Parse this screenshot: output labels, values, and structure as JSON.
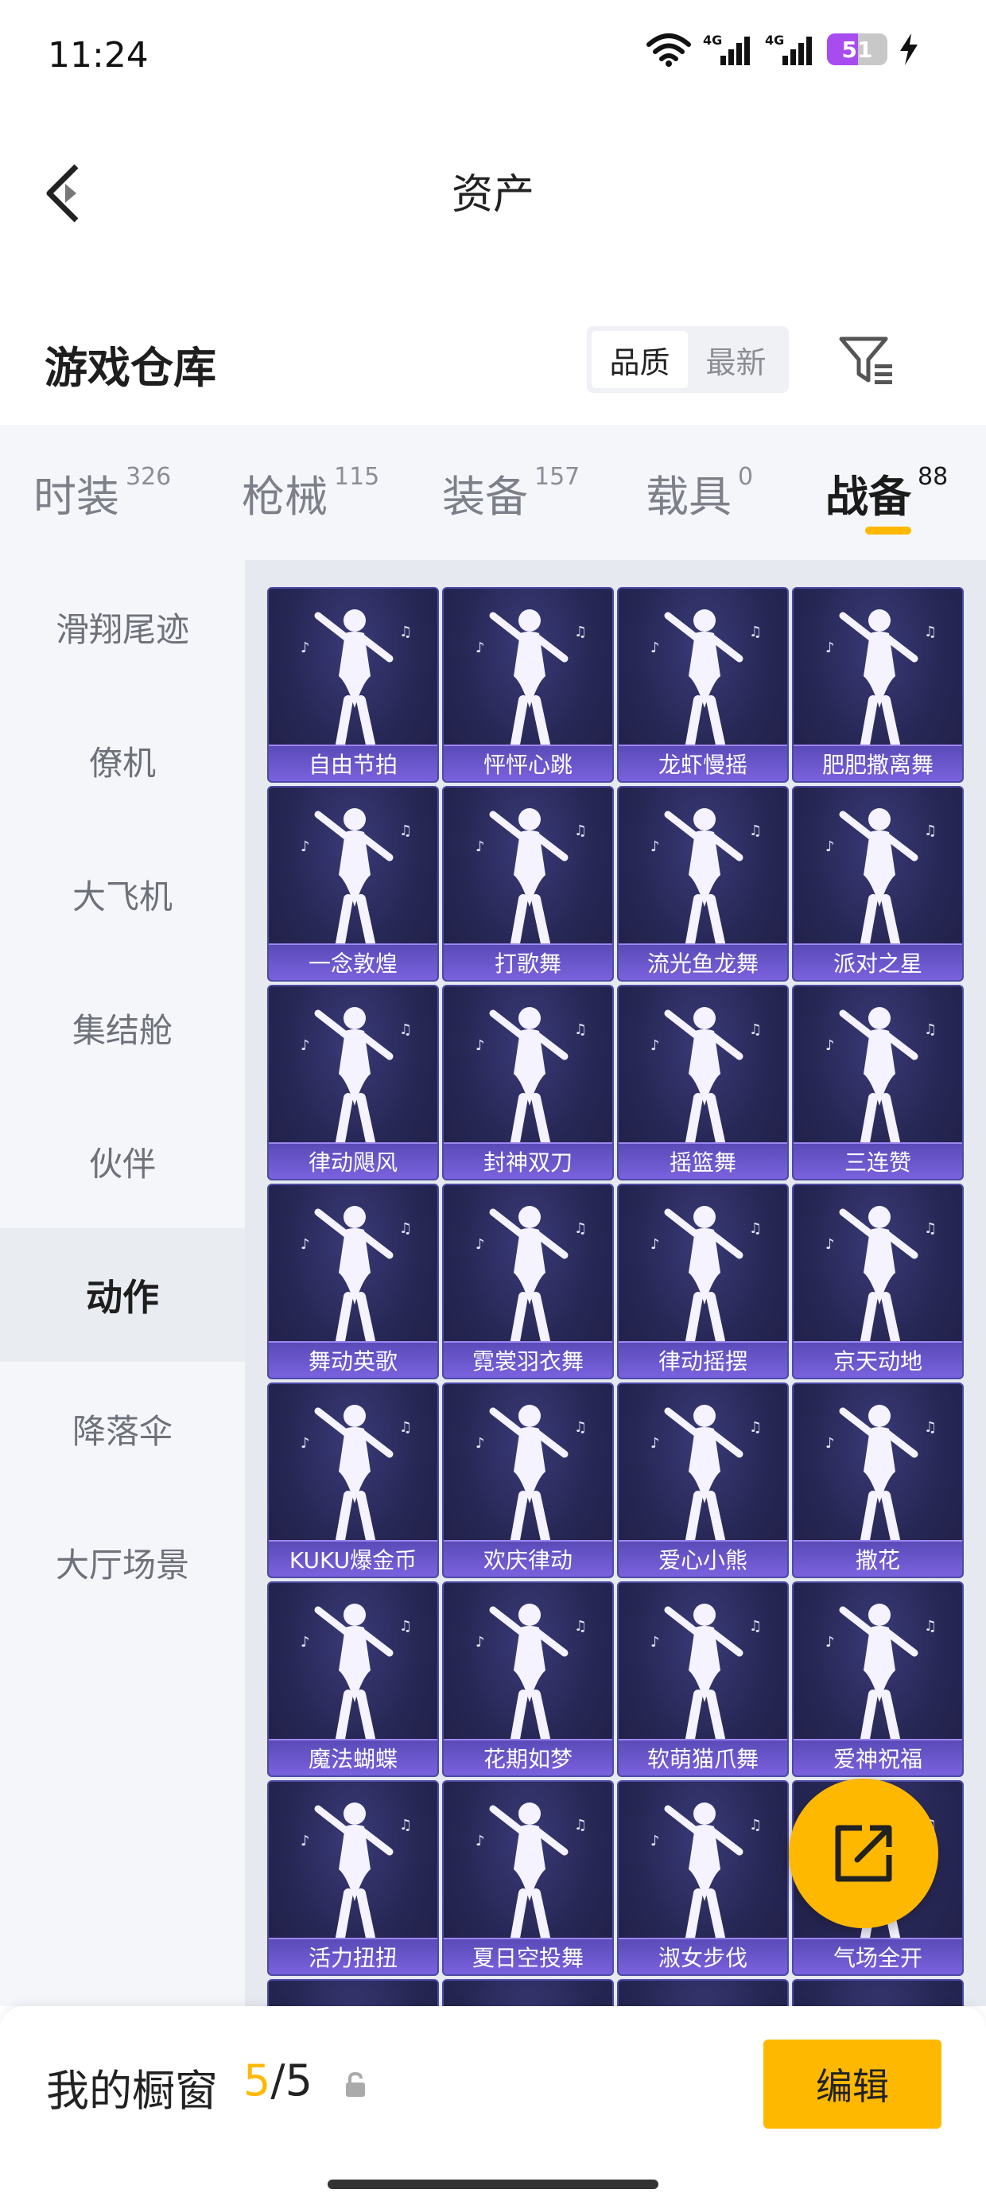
{
  "status": {
    "time": "11:24",
    "battery": "51",
    "battery_level": 0.51
  },
  "header": {
    "title": "资产",
    "back_icon": "chevron-left-icon"
  },
  "warehouse": {
    "title": "游戏仓库",
    "sort_options": [
      "品质",
      "最新"
    ],
    "sort_selected": "品质",
    "filter_icon": "filter-icon"
  },
  "tabs": [
    {
      "label": "时装",
      "count": "326"
    },
    {
      "label": "枪械",
      "count": "115"
    },
    {
      "label": "装备",
      "count": "157"
    },
    {
      "label": "载具",
      "count": "0"
    },
    {
      "label": "战备",
      "count": "88"
    }
  ],
  "tab_selected": "战备",
  "sidenav": {
    "items": [
      "滑翔尾迹",
      "僚机",
      "大飞机",
      "集结舱",
      "伙伴",
      "动作",
      "降落伞",
      "大厅场景"
    ],
    "selected": "动作"
  },
  "items": [
    "自由节拍",
    "怦怦心跳",
    "龙虾慢摇",
    "肥肥撒离舞",
    "一念敦煌",
    "打歌舞",
    "流光鱼龙舞",
    "派对之星",
    "律动飓风",
    "封神双刀",
    "摇篮舞",
    "三连赞",
    "舞动英歌",
    "霓裳羽衣舞",
    "律动摇摆",
    "京天动地",
    "KUKU爆金币",
    "欢庆律动",
    "爱心小熊",
    "撒花",
    "魔法蝴蝶",
    "花期如梦",
    "软萌猫爪舞",
    "爱神祝福",
    "活力扭扭",
    "夏日空投舞",
    "淑女步伐",
    "气场全开"
  ],
  "share_icon": "share-icon",
  "showcase": {
    "label": "我的橱窗",
    "current": "5",
    "separator": "/",
    "total": "5",
    "lock_icon": "lock-icon"
  },
  "edit_label": "编辑",
  "colors": {
    "accent": "#ffb800",
    "card_bg": "#272755",
    "card_label": "#6a56cc"
  }
}
